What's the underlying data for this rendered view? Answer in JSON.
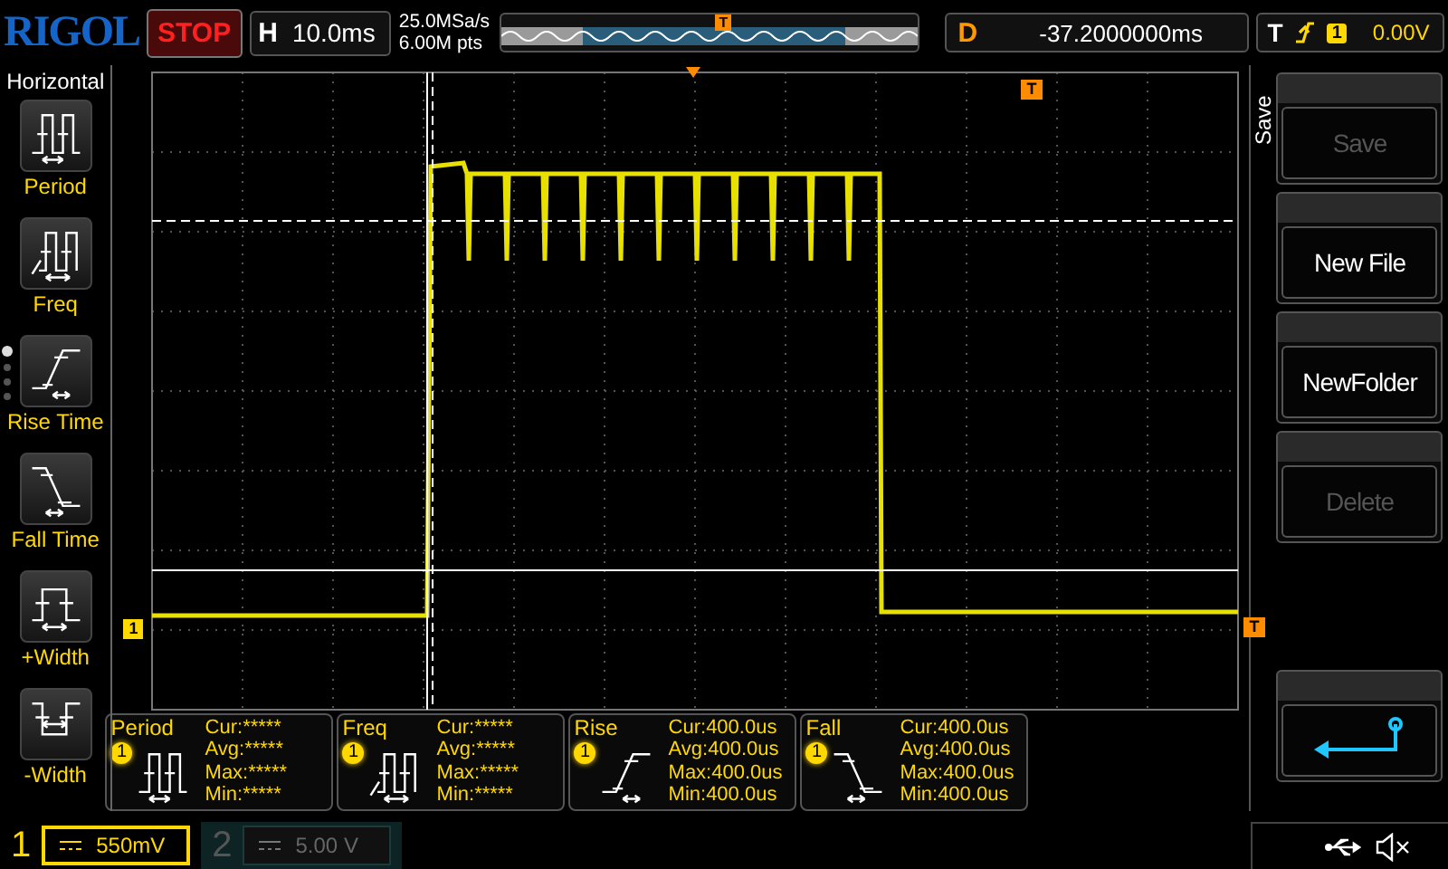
{
  "top_bar": {
    "brand": "RIGOL",
    "run_status": "STOP",
    "timebase": {
      "label": "H",
      "value": "10.0ms"
    },
    "sample_rate": "25.0MSa/s",
    "memory_depth": "6.00M pts",
    "memory_trigger_label": "T",
    "delay": {
      "label": "D",
      "value": "-37.2000000ms"
    },
    "trigger": {
      "label": "T",
      "source": "1",
      "level": "0.00V"
    }
  },
  "left_menu": {
    "title": "Horizontal",
    "items": [
      {
        "kind": "period",
        "label": "Period"
      },
      {
        "kind": "freq",
        "label": "Freq"
      },
      {
        "kind": "rise",
        "label": "Rise Time"
      },
      {
        "kind": "fall",
        "label": "Fall Time"
      },
      {
        "kind": "pwidth",
        "label": "+Width"
      },
      {
        "kind": "nwidth",
        "label": "-Width"
      }
    ],
    "pages": [
      {
        "selected": true
      },
      {
        "selected": false
      },
      {
        "selected": false
      },
      {
        "selected": false
      }
    ]
  },
  "waveform_area": {
    "channel_marker": "1",
    "trigger_level_marker": "T",
    "trigger_position_marker": "T"
  },
  "measurements": [
    {
      "kind": "period",
      "name": "Period",
      "source": "1",
      "rows": [
        {
          "label": "Cur:",
          "value": "*****"
        },
        {
          "label": "Avg:",
          "value": "*****"
        },
        {
          "label": "Max:",
          "value": "*****"
        },
        {
          "label": "Min:",
          "value": "*****"
        }
      ]
    },
    {
      "kind": "freq",
      "name": "Freq",
      "source": "1",
      "rows": [
        {
          "label": "Cur:",
          "value": "*****"
        },
        {
          "label": "Avg:",
          "value": "*****"
        },
        {
          "label": "Max:",
          "value": "*****"
        },
        {
          "label": "Min:",
          "value": "*****"
        }
      ]
    },
    {
      "kind": "rise",
      "name": "Rise",
      "source": "1",
      "rows": [
        {
          "label": "Cur:",
          "value": "400.0us"
        },
        {
          "label": "Avg:",
          "value": "400.0us"
        },
        {
          "label": "Max:",
          "value": "400.0us"
        },
        {
          "label": "Min:",
          "value": "400.0us"
        }
      ]
    },
    {
      "kind": "fall",
      "name": "Fall",
      "source": "1",
      "rows": [
        {
          "label": "Cur:",
          "value": "400.0us"
        },
        {
          "label": "Avg:",
          "value": "400.0us"
        },
        {
          "label": "Max:",
          "value": "400.0us"
        },
        {
          "label": "Min:",
          "value": "400.0us"
        }
      ]
    }
  ],
  "right_menu": {
    "title": "Save",
    "buttons": [
      {
        "kind": "text",
        "label": "Save",
        "disabled": true
      },
      {
        "kind": "text",
        "label": "New File",
        "disabled": false
      },
      {
        "kind": "text",
        "label": "NewFolder",
        "disabled": false
      },
      {
        "kind": "text",
        "label": "Delete",
        "disabled": true
      },
      {
        "kind": "back"
      }
    ]
  },
  "channels": [
    {
      "number": "1",
      "scale": "550mV",
      "enabled": true
    },
    {
      "number": "2",
      "scale": "5.00 V",
      "enabled": false
    }
  ]
}
